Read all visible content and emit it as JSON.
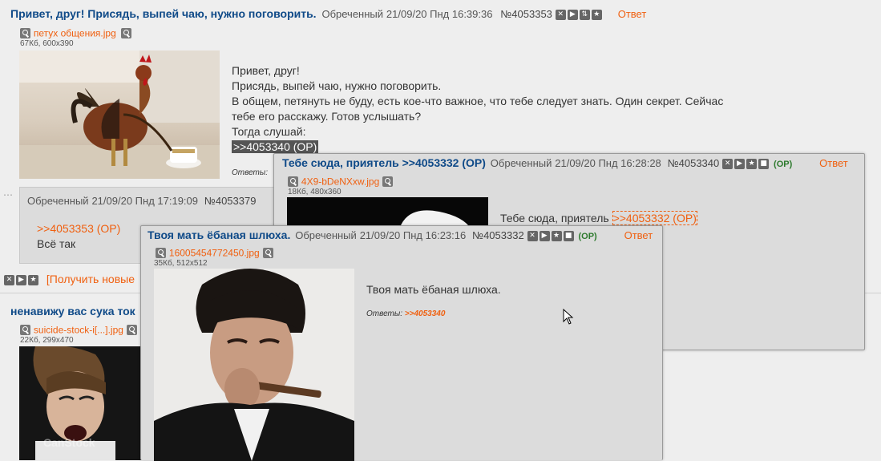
{
  "op_post": {
    "subject": "Привет, друг! Присядь, выпей чаю, нужно поговорить.",
    "name": "Обреченный",
    "datetime": "21/09/20 Пнд 16:39:36",
    "number": "№4053353",
    "reply_label": "Ответ",
    "file_name": "петух общения.jpg",
    "file_info": "67Кб, 600x390",
    "lines": [
      "Привет, друг!",
      "Присядь, выпей чаю, нужно поговорить.",
      "В общем, петянуть не буду, есть кое-что важное, что тебе следует знать. Один секрет. Сейчас",
      "тебе его расскажу. Готов услышать?",
      "Тогда слушай:"
    ],
    "quote_link": ">>4053340 (OP)",
    "answers_label": "Ответы:"
  },
  "reply_post": {
    "name": "Обреченный",
    "datetime": "21/09/20 Пнд 17:19:09",
    "number": "№4053379",
    "quote_link": ">>4053353 (OP)",
    "text": "Всё так"
  },
  "thread_controls": {
    "get_new_label": "[Получить новые"
  },
  "next_thread": {
    "subject": "ненавижу вас сука ток",
    "file_name": "suicide-stock-i[...].jpg",
    "file_info": "22Кб, 299x470",
    "watermark": "CanStock"
  },
  "popup1": {
    "subject": "Тебе сюда, приятель >>4053332 (OP)",
    "name": "Обреченный",
    "datetime": "21/09/20 Пнд 16:28:28",
    "number": "№4053340",
    "op_badge": "(OP)",
    "reply_label": "Ответ",
    "file_name": "4X9-bDeNXxw.jpg",
    "file_info": "18Кб, 480x360",
    "text": "Тебе сюда, приятель",
    "quote_link": ">>4053332 (OP)"
  },
  "popup2": {
    "subject": "Твоя мать ёбаная шлюха.",
    "name": "Обреченный",
    "datetime": "21/09/20 Пнд 16:23:16",
    "number": "№4053332",
    "op_badge": "(OP)",
    "reply_label": "Ответ",
    "file_name": "16005454772450.jpg",
    "file_info": "35Кб, 512x512",
    "text": "Твоя мать ёбаная шлюха.",
    "answers_label": "Ответы:",
    "answers_link": ">>4053340"
  },
  "icons": {
    "hide": "✕",
    "play": "▶",
    "up": "⇅",
    "star": "★",
    "stop": "■"
  }
}
